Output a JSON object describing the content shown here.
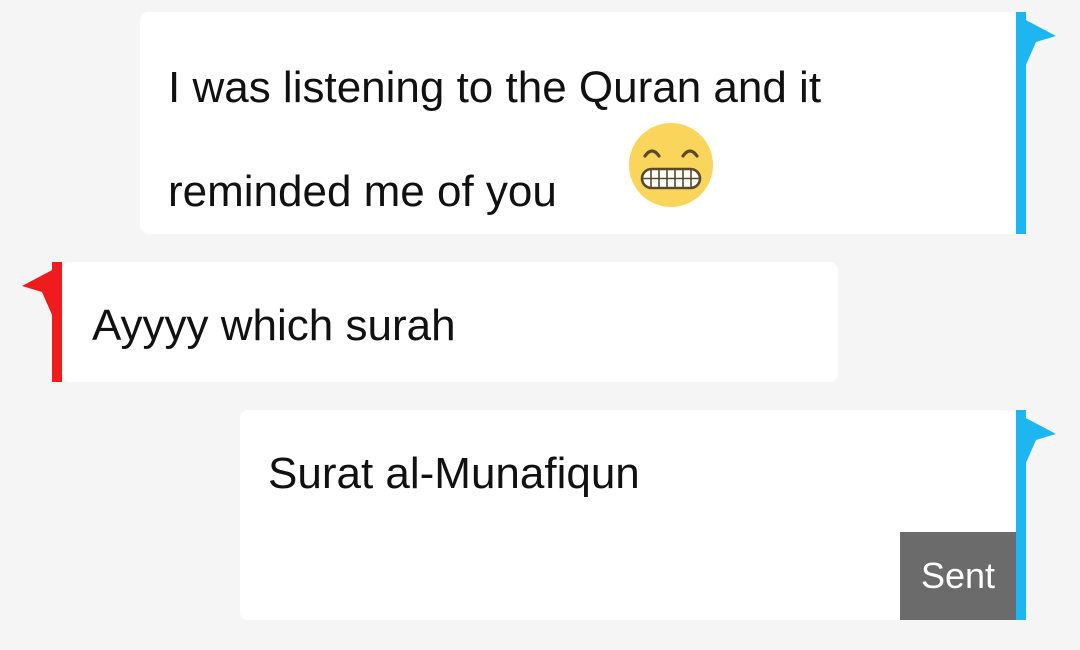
{
  "conversation": {
    "messages": [
      {
        "direction": "outgoing",
        "lines": [
          "I was listening to the Quran and it",
          "reminded me of you"
        ],
        "emoji": "grinning-face-emoji"
      },
      {
        "direction": "incoming",
        "lines": [
          "Ayyyy which surah"
        ]
      },
      {
        "direction": "outgoing",
        "lines": [
          "Surat al-Munafiqun"
        ],
        "status": "Sent"
      }
    ]
  },
  "colors": {
    "background": "#f5f5f5",
    "bubble": "#ffffff",
    "outgoing_accent": "#1eb6f0",
    "incoming_accent": "#ee1c1c",
    "status_badge": "#6b6b6b",
    "emoji_face": "#f9d55c"
  }
}
